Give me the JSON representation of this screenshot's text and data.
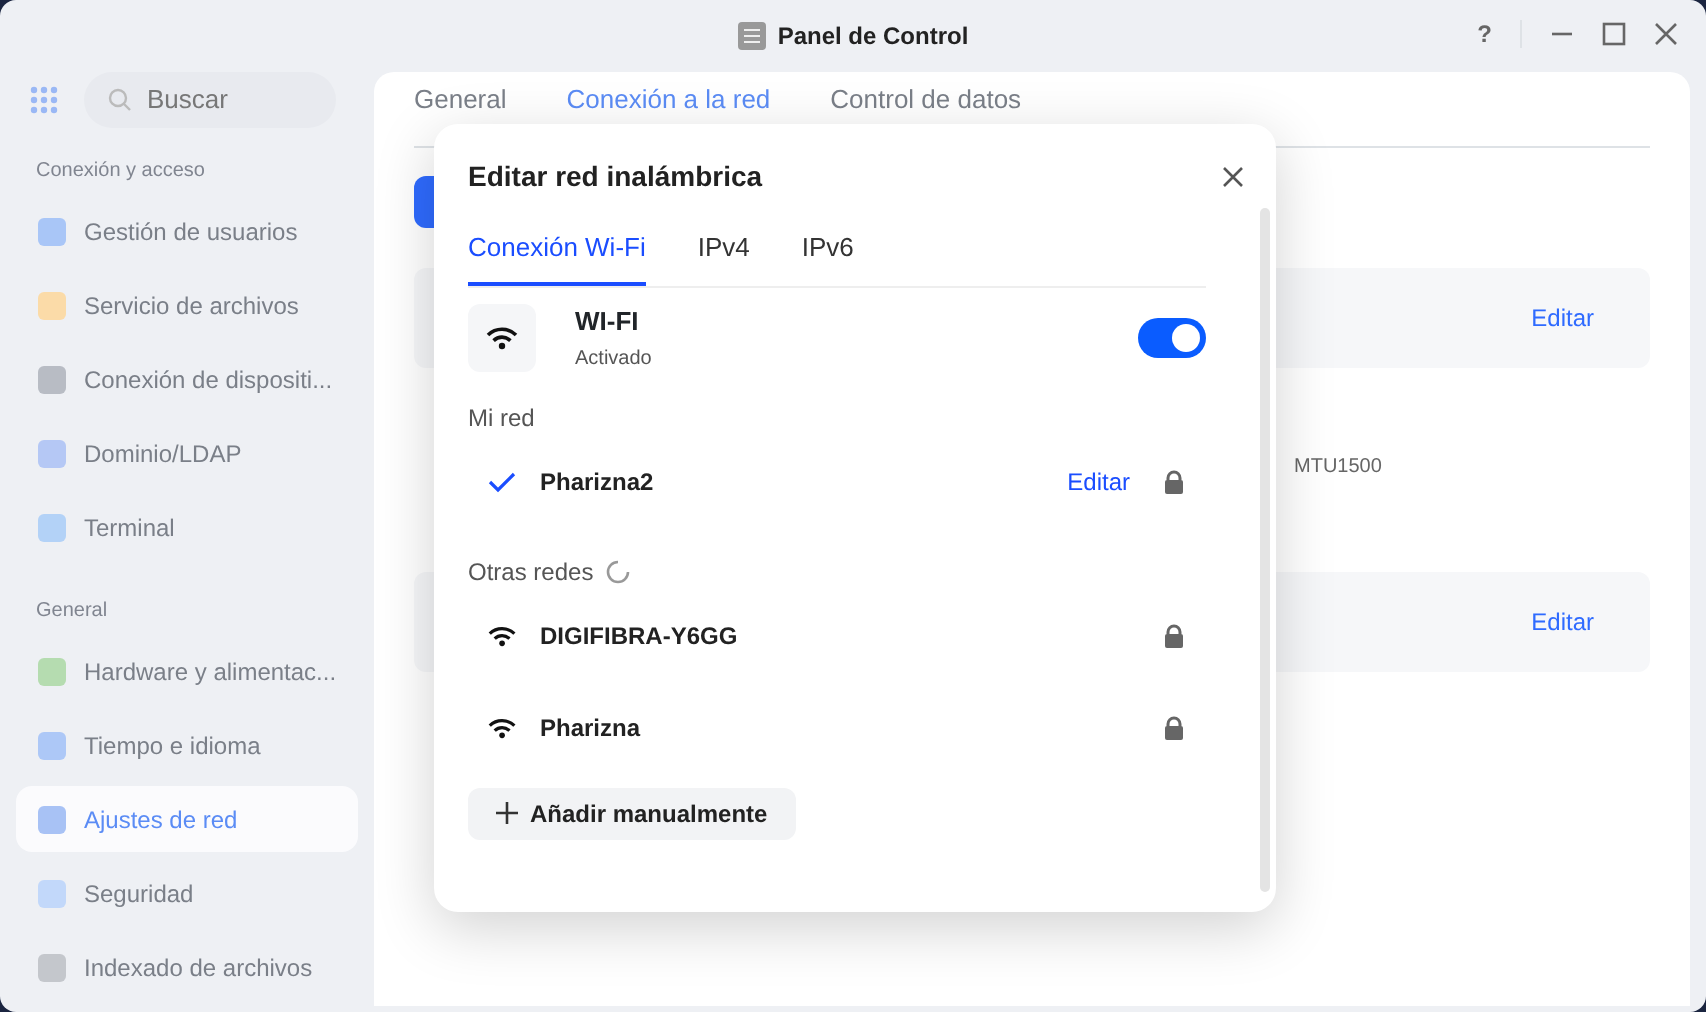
{
  "window": {
    "title": "Panel de Control",
    "help": "?"
  },
  "sidebar": {
    "search": {
      "placeholder": "Buscar"
    },
    "sections": [
      {
        "label": "Conexión y acceso",
        "items": [
          {
            "label": "Gestión de usuarios",
            "selected": false,
            "color": "#a9c6f7"
          },
          {
            "label": "Servicio de archivos",
            "selected": false,
            "color": "#fbdba8"
          },
          {
            "label": "Conexión de dispositi...",
            "selected": false,
            "color": "#b8bcc4"
          },
          {
            "label": "Dominio/LDAP",
            "selected": false,
            "color": "#b5c8f5"
          },
          {
            "label": "Terminal",
            "selected": false,
            "color": "#b3d2f7"
          }
        ]
      },
      {
        "label": "General",
        "items": [
          {
            "label": "Hardware y alimentac...",
            "selected": false,
            "color": "#b5dcb0"
          },
          {
            "label": "Tiempo e idioma",
            "selected": false,
            "color": "#adc8f7"
          },
          {
            "label": "Ajustes de red",
            "selected": true,
            "color": "#a8c2f5"
          },
          {
            "label": "Seguridad",
            "selected": false,
            "color": "#c2d8fa"
          },
          {
            "label": "Indexado de archivos",
            "selected": false,
            "color": "#c4c7cc"
          }
        ]
      }
    ]
  },
  "content": {
    "tabs": [
      {
        "label": "General",
        "selected": false
      },
      {
        "label": "Conexión a la red",
        "selected": true
      },
      {
        "label": "Control de datos",
        "selected": false
      }
    ],
    "cards": [
      {
        "action": "Editar"
      },
      {
        "detail": "MTU1500"
      },
      {
        "action": "Editar"
      }
    ]
  },
  "dialog": {
    "title": "Editar red inalámbrica",
    "tabs": [
      {
        "label": "Conexión Wi-Fi",
        "selected": true
      },
      {
        "label": "IPv4",
        "selected": false
      },
      {
        "label": "IPv6",
        "selected": false
      }
    ],
    "wifi": {
      "name": "WI-FI",
      "status": "Activado",
      "on": true
    },
    "my_network": {
      "label": "Mi red",
      "networks": [
        {
          "name": "Pharizna2",
          "connected": true,
          "action": "Editar",
          "locked": true
        }
      ]
    },
    "other_networks": {
      "label": "Otras redes",
      "loading": true,
      "networks": [
        {
          "name": "DIGIFIBRA-Y6GG",
          "connected": false,
          "locked": true
        },
        {
          "name": "Pharizna",
          "connected": false,
          "locked": true
        }
      ]
    },
    "add_button": "Añadir manualmente"
  }
}
